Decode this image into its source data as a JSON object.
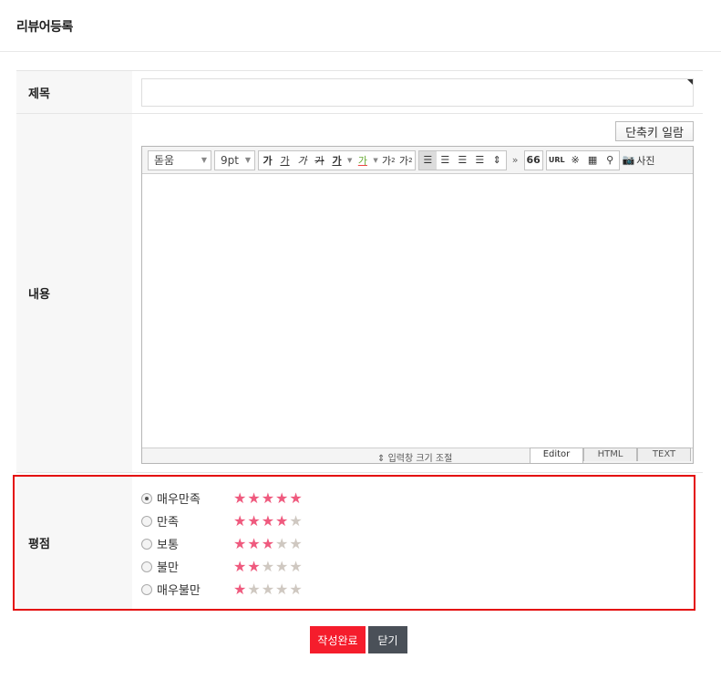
{
  "header": {
    "title": "리뷰어등록"
  },
  "form": {
    "title_label": "제목",
    "title_value": "",
    "content_label": "내용",
    "shortcut_button": "단축키 일람",
    "rating_label": "평점"
  },
  "editor": {
    "font_select": "돋움",
    "size_select": "9pt",
    "format_buttons": [
      "가",
      "가",
      "가",
      "가",
      "가",
      "가"
    ],
    "superscript": "가",
    "subscript": "가",
    "more": "»",
    "quote": "66",
    "url": "URL",
    "special_char": "※",
    "photo": "사진",
    "resize_label": "입력창 크기 조절",
    "tabs": [
      "Editor",
      "HTML",
      "TEXT"
    ]
  },
  "ratings": [
    {
      "label": "매우만족",
      "stars": 5,
      "checked": true
    },
    {
      "label": "만족",
      "stars": 4,
      "checked": false
    },
    {
      "label": "보통",
      "stars": 3,
      "checked": false
    },
    {
      "label": "불만",
      "stars": 2,
      "checked": false
    },
    {
      "label": "매우불만",
      "stars": 1,
      "checked": false
    }
  ],
  "actions": {
    "submit": "작성완료",
    "close": "닫기"
  },
  "colors": {
    "highlight_border": "#e40a0a",
    "star_on": "#ef5a7e",
    "star_off": "#cfc8c1",
    "submit_bg": "#f51d2c",
    "close_bg": "#4a5058"
  }
}
